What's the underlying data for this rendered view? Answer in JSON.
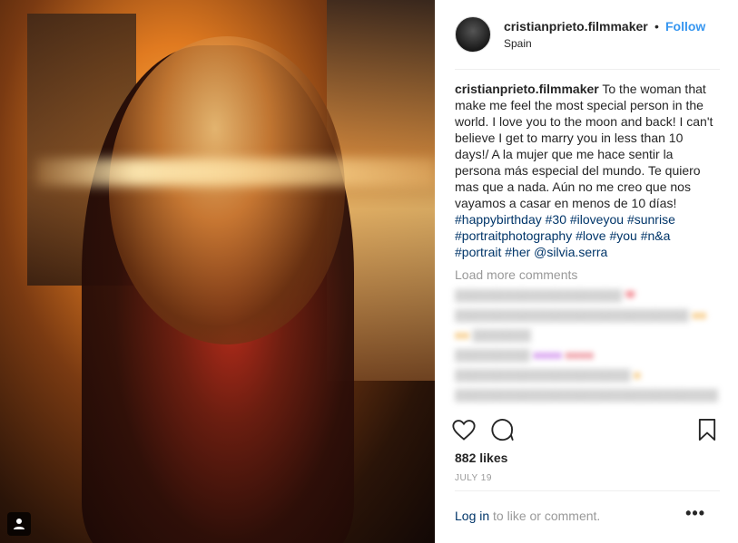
{
  "post": {
    "username": "cristianprieto.filmmaker",
    "separator": "•",
    "follow_label": "Follow",
    "location": "Spain",
    "caption": {
      "user": "cristianprieto.filmmaker",
      "text": "To the woman that make me feel the most special person in the world. I love you to the moon and back! I can't believe I get to marry you in less than 10 days!/ A la mujer que me hace sentir la persona más especial del mundo. Te quiero mas que a nada. Aún no me creo que nos vayamos a casar en menos de 10 días!",
      "tags": [
        "#happybirthday",
        "#30",
        "#iloveyou",
        "#sunrise",
        "#portraitphotography",
        "#love",
        "#you",
        "#n&a",
        "#portrait",
        "#her",
        "@silvia.serra"
      ]
    },
    "load_more_label": "Load more comments",
    "likes": "882 likes",
    "date": "JULY 19",
    "login_label": "Log in",
    "login_suffix": " to like or comment.",
    "more_label": "•••"
  },
  "icons": {
    "like": "heart-outline-icon",
    "comment": "speech-bubble-icon",
    "bookmark": "bookmark-icon",
    "more": "ellipsis-icon",
    "tag": "person-tag-icon"
  },
  "colors": {
    "link_blue": "#3897f0",
    "hashtag_blue": "#003569",
    "muted": "#999999",
    "text": "#262626"
  }
}
